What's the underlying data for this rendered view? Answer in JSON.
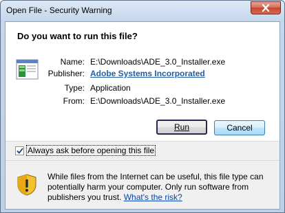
{
  "window": {
    "title": "Open File - Security Warning"
  },
  "dialog": {
    "question": "Do you want to run this file?",
    "fields": [
      {
        "label": "Name:",
        "value": "E:\\Downloads\\ADE_3.0_Installer.exe"
      },
      {
        "label": "Publisher:",
        "value": "Adobe Systems Incorporated"
      },
      {
        "label": "Type:",
        "value": "Application"
      },
      {
        "label": "From:",
        "value": "E:\\Downloads\\ADE_3.0_Installer.exe"
      }
    ],
    "run_label": "Run",
    "cancel_label": "Cancel",
    "checkbox_label": "Always ask before opening this file",
    "checkbox_checked": true,
    "warning_text": "While files from the Internet can be useful, this file type can potentially harm your computer. Only run software from publishers you trust.",
    "risk_link": "What's the risk?"
  },
  "colors": {
    "link": "#0645ad",
    "close_button": "#c7442c"
  },
  "icons": {
    "close": "close-icon",
    "file": "executable-file-icon",
    "shield": "warning-shield-icon",
    "check": "checkmark-icon"
  }
}
